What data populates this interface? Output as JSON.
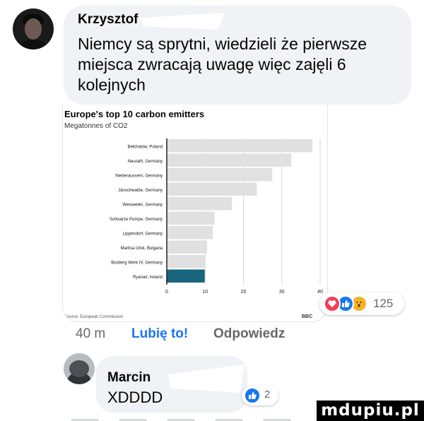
{
  "comment": {
    "author": "Krzysztof",
    "text": "Niemcy są sprytni, wiedzieli że pierwsze miejsca zwracają uwagę więc zajęli 6 kolejnych",
    "time": "40 m",
    "like_label": "Lubię to!",
    "reply_label": "Odpowiedz",
    "reactions": {
      "icons": [
        "heart-icon",
        "like-icon",
        "wow-icon"
      ],
      "count": "125"
    }
  },
  "chart_data": {
    "type": "bar",
    "orientation": "horizontal",
    "title": "Europe's top 10 carbon emitters",
    "subtitle": "Megatonnes of CO2",
    "categories": [
      "Bełchatów, Poland",
      "Neurath, Germany",
      "Niederaussem, Germany",
      "Jänschwalde, Germany",
      "Weisweiler, Germany",
      "Schwarze Pumpe, Germany",
      "Lippendorf, Germany",
      "Maritsa Iztok, Bulgaria",
      "Boxberg Werk IV, Germany",
      "Ryanair, Ireland"
    ],
    "values": [
      38,
      32.5,
      27.5,
      23.5,
      17,
      12.5,
      12,
      10.5,
      10,
      9.9
    ],
    "highlight_index": 9,
    "xlim": [
      0,
      40
    ],
    "xticks": [
      "0",
      "10",
      "20",
      "30",
      "40"
    ],
    "source": "Source: European Commission",
    "badge": "BBC",
    "colors": {
      "bar": "#e0e0e0",
      "highlight": "#17657f",
      "axis": "#222222",
      "grid": "#d9d9d9"
    }
  },
  "reply": {
    "author": "Marcin",
    "text": "XDDDD",
    "reactions": {
      "icons": [
        "like-icon"
      ],
      "count": "2"
    }
  },
  "watermark": "mdupiu.pl"
}
